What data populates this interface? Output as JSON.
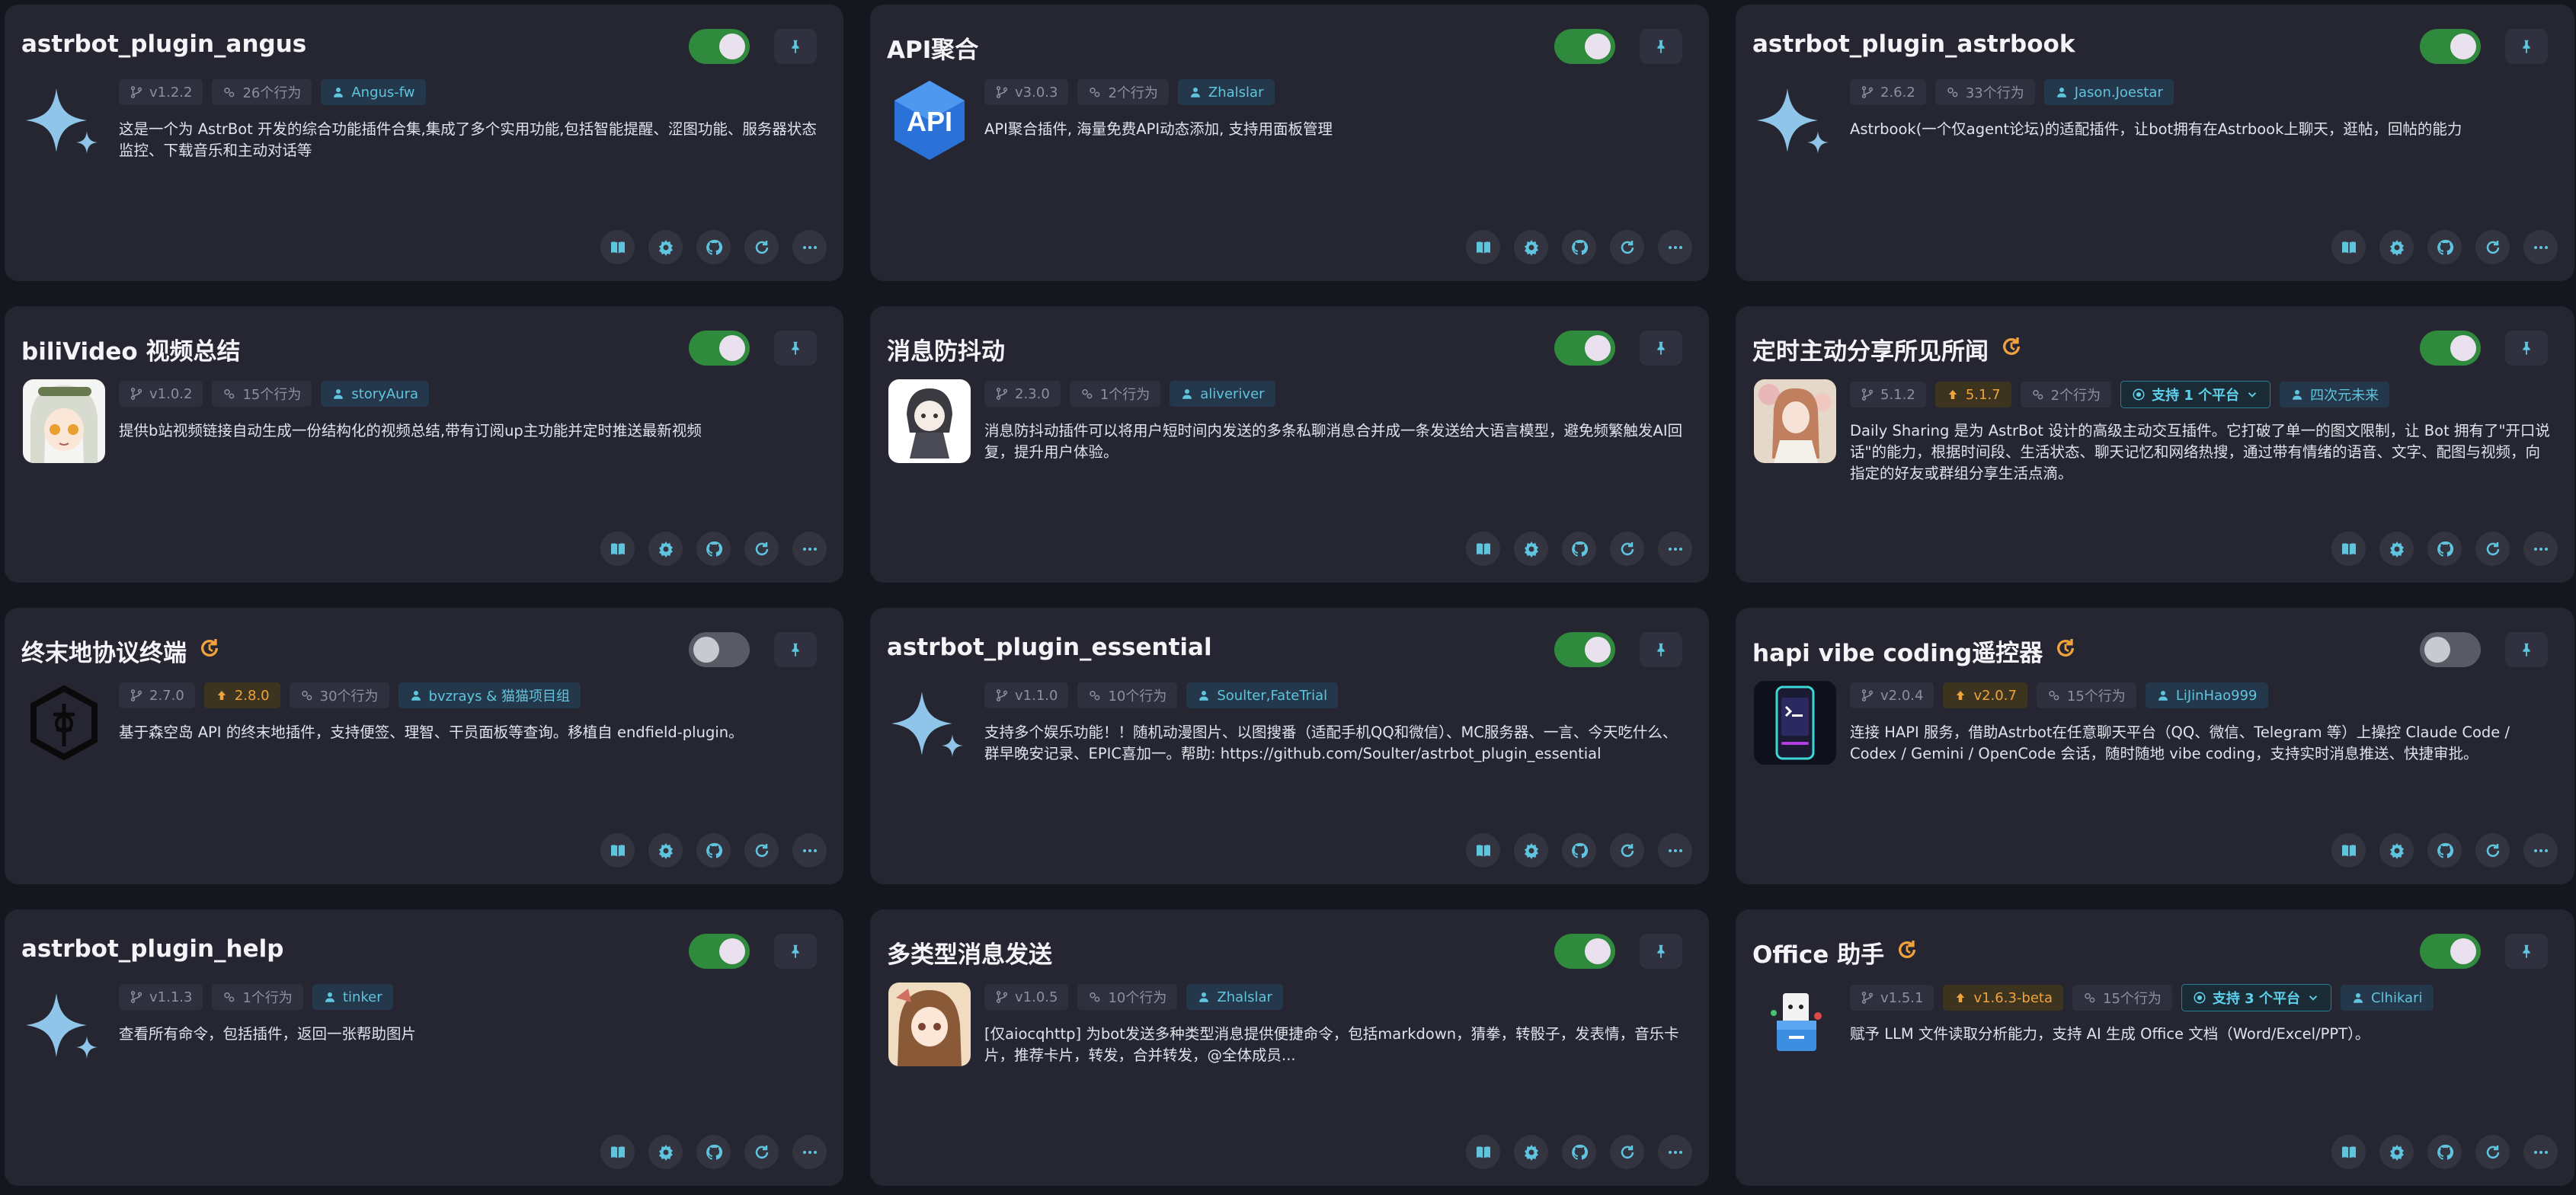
{
  "colors": {
    "accent": "#5fc4de",
    "toggle_on": "#2f8a3e",
    "toggle_off": "#5a5a66",
    "update": "#f0a23c"
  },
  "cards": [
    {
      "title": "astrbot_plugin_angus",
      "enabled": true,
      "avatar": "sparkle",
      "version": "v1.2.2",
      "actions_count": "26个行为",
      "author": "Angus-fw",
      "description": "这是一个为 AstrBot 开发的综合功能插件合集,集成了多个实用功能,包括智能提醒、涩图功能、服务器状态监控、下载音乐和主动对话等"
    },
    {
      "title": "API聚合",
      "enabled": true,
      "avatar": "api",
      "avatar_text": "API",
      "version": "v3.0.3",
      "actions_count": "2个行为",
      "author": "Zhalslar",
      "description": "API聚合插件, 海量免费API动态添加, 支持用面板管理"
    },
    {
      "title": "astrbot_plugin_astrbook",
      "enabled": true,
      "avatar": "sparkle",
      "version": "2.6.2",
      "actions_count": "33个行为",
      "author": "Jason.Joestar",
      "description": "Astrbook(一个仅agent论坛)的适配插件，让bot拥有在Astrbook上聊天，逛帖，回帖的能力"
    },
    {
      "title": "biliVideo 视频总结",
      "enabled": true,
      "avatar": "anime1",
      "version": "v1.0.2",
      "actions_count": "15个行为",
      "author": "storyAura",
      "description": "提供b站视频链接自动生成一份结构化的视频总结,带有订阅up主功能并定时推送最新视频"
    },
    {
      "title": "消息防抖动",
      "enabled": true,
      "avatar": "anime2",
      "version": "2.3.0",
      "actions_count": "1个行为",
      "author": "aliveriver",
      "description": "消息防抖动插件可以将用户短时间内发送的多条私聊消息合并成一条发送给大语言模型，避免频繁触发AI回复，提升用户体验。"
    },
    {
      "title": "定时主动分享所见所闻",
      "enabled": true,
      "has_update": true,
      "avatar": "anime3",
      "version": "5.1.2",
      "update_version": "5.1.7",
      "actions_count": "2个行为",
      "platform": "支持 1 个平台",
      "author": "四次元未来",
      "description": "Daily Sharing 是为 AstrBot 设计的高级主动交互插件。它打破了单一的图文限制，让 Bot 拥有了\"开口说话\"的能力，根据时间段、生活状态、聊天记忆和网络热搜，通过带有情绪的语音、文字、配图与视频，向指定的好友或群组分享生活点滴。"
    },
    {
      "title": "终末地协议终端",
      "enabled": false,
      "has_update": true,
      "avatar": "hex",
      "version": "2.7.0",
      "update_version": "2.8.0",
      "actions_count": "30个行为",
      "author": "bvzrays & 猫猫项目组",
      "description": "基于森空岛 API 的终末地插件，支持便签、理智、干员面板等查询。移植自 endfield-plugin。"
    },
    {
      "title": "astrbot_plugin_essential",
      "enabled": true,
      "avatar": "sparkle",
      "version": "v1.1.0",
      "actions_count": "10个行为",
      "author": "Soulter,FateTrial",
      "description": "支持多个娱乐功能！！随机动漫图片、以图搜番（适配手机QQ和微信）、MC服务器、一言、今天吃什么、群早晚安记录、EPIC喜加一。帮助: https://github.com/Soulter/astrbot_plugin_essential"
    },
    {
      "title": "hapi vibe coding遥控器",
      "enabled": false,
      "has_update": true,
      "avatar": "phone",
      "version": "v2.0.4",
      "update_version": "v2.0.7",
      "actions_count": "15个行为",
      "author": "LiJinHao999",
      "description": "连接 HAPI 服务，借助Astrbot在任意聊天平台（QQ、微信、Telegram 等）上操控 Claude Code / Codex / Gemini / OpenCode 会话，随时随地 vibe coding，支持实时消息推送、快捷审批。"
    },
    {
      "title": "astrbot_plugin_help",
      "enabled": true,
      "avatar": "sparkle",
      "version": "v1.1.3",
      "actions_count": "1个行为",
      "author": "tinker",
      "description": "查看所有命令，包括插件，返回一张帮助图片"
    },
    {
      "title": "多类型消息发送",
      "enabled": true,
      "avatar": "anime4",
      "version": "v1.0.5",
      "actions_count": "10个行为",
      "author": "Zhalslar",
      "description": "[仅aiocqhttp] 为bot发送多种类型消息提供便捷命令，包括markdown，猜拳，转骰子，发表情，音乐卡片，推荐卡片，转发，合并转发，@全体成员..."
    },
    {
      "title": "Office 助手",
      "enabled": true,
      "has_update": true,
      "avatar": "office",
      "version": "v1.5.1",
      "update_version": "v1.6.3-beta",
      "actions_count": "15个行为",
      "platform": "支持 3 个平台",
      "author": "Clhikari",
      "description": "赋予 LLM 文件读取分析能力，支持 AI 生成 Office 文档（Word/Excel/PPT）。"
    }
  ]
}
